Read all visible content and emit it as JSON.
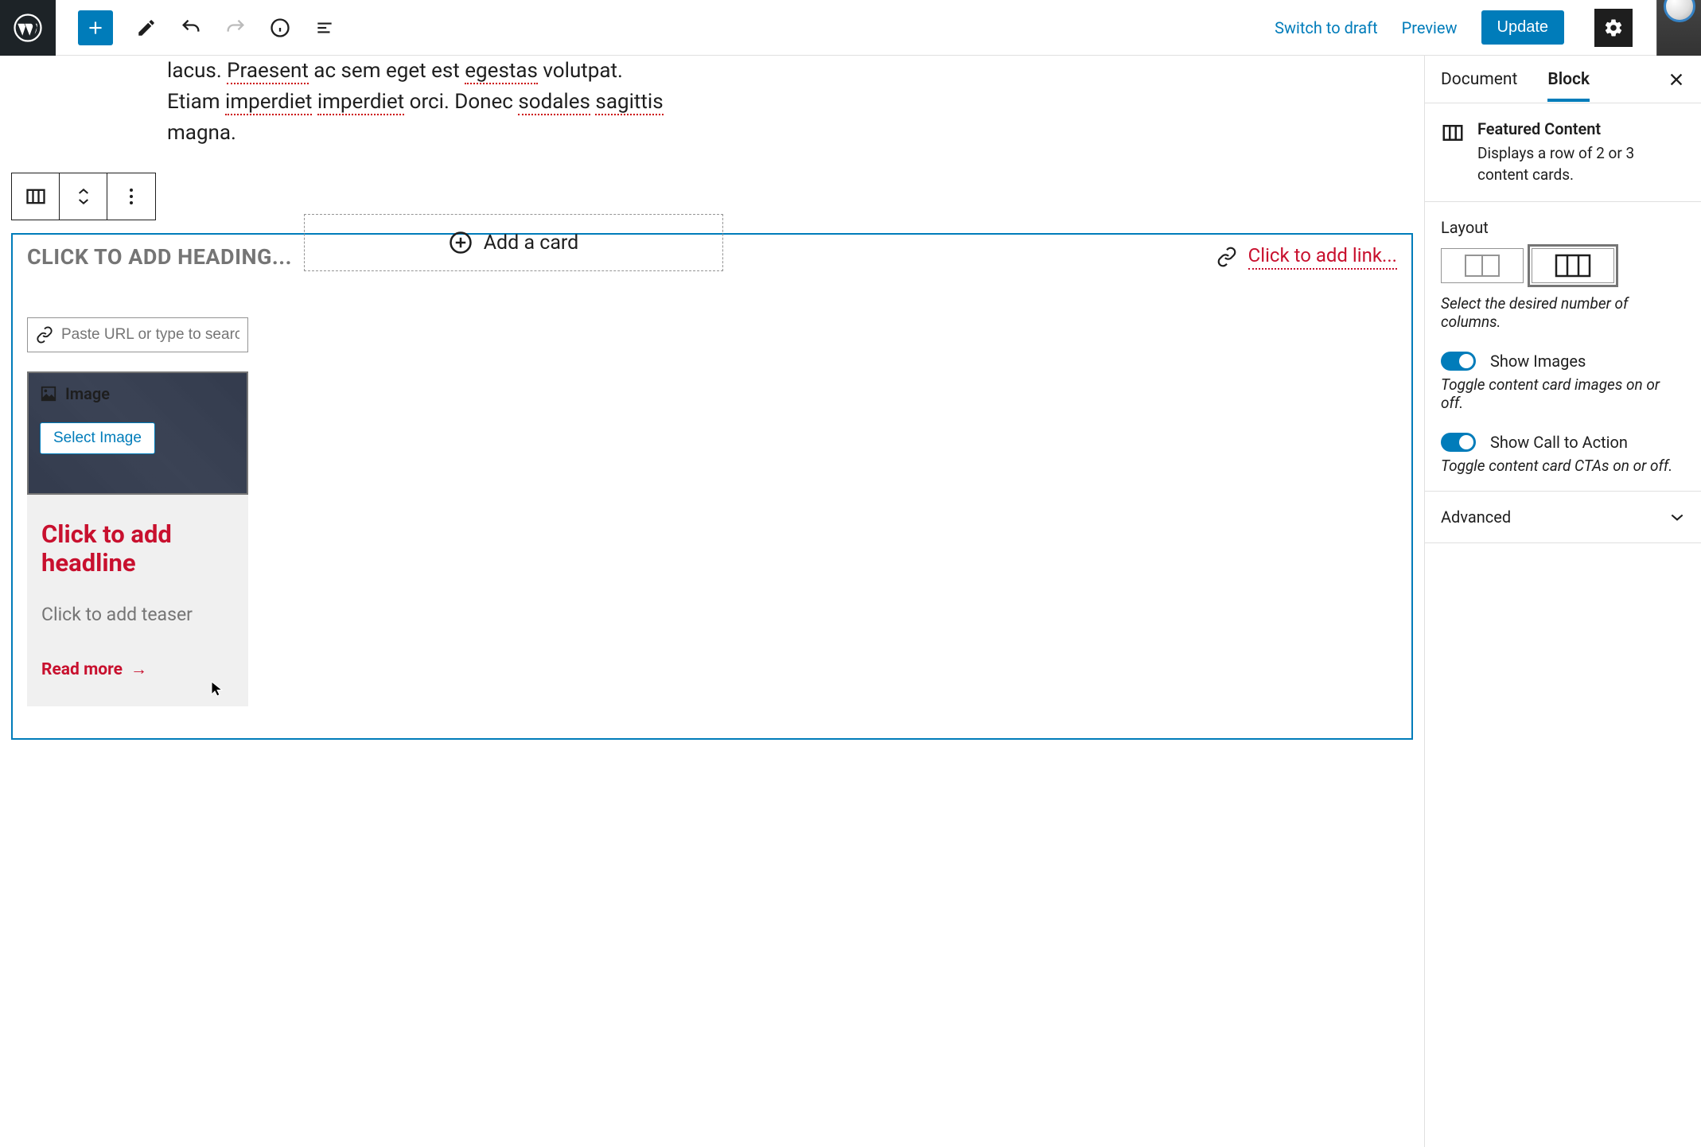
{
  "topbar": {
    "switch_draft": "Switch to draft",
    "preview": "Preview",
    "update": "Update"
  },
  "paragraph": {
    "line1a": "lacus. ",
    "line1b": "Praesent",
    "line1c": " ac sem eget est ",
    "line1d": "egestas",
    "line1e": " volutpat.",
    "line2a": "Etiam ",
    "line2b": "imperdiet",
    "line2c": " ",
    "line2d": "imperdiet",
    "line2e": " orci. Donec ",
    "line2f": "sodales",
    "line2g": " ",
    "line2h": "sagittis",
    "line3": "magna."
  },
  "featured": {
    "heading_placeholder": "CLICK TO ADD HEADING...",
    "link_placeholder": "Click to add link...",
    "url_placeholder": "Paste URL or type to search",
    "add_card": "Add a card",
    "image_label": "Image",
    "select_image": "Select Image",
    "headline_placeholder": "Click to add headline",
    "teaser_placeholder": "Click to add teaser",
    "cta_label": "Read more"
  },
  "sidebar": {
    "tabs": {
      "document": "Document",
      "block": "Block"
    },
    "block": {
      "name": "Featured Content",
      "desc": "Displays a row of 2 or 3 content cards."
    },
    "layout": {
      "label": "Layout",
      "help": "Select the desired number of columns.",
      "selected": 3
    },
    "show_images": {
      "label": "Show Images",
      "help": "Toggle content card images on or off.",
      "value": true
    },
    "show_cta": {
      "label": "Show Call to Action",
      "help": "Toggle content card CTAs on or off.",
      "value": true
    },
    "advanced": "Advanced"
  }
}
